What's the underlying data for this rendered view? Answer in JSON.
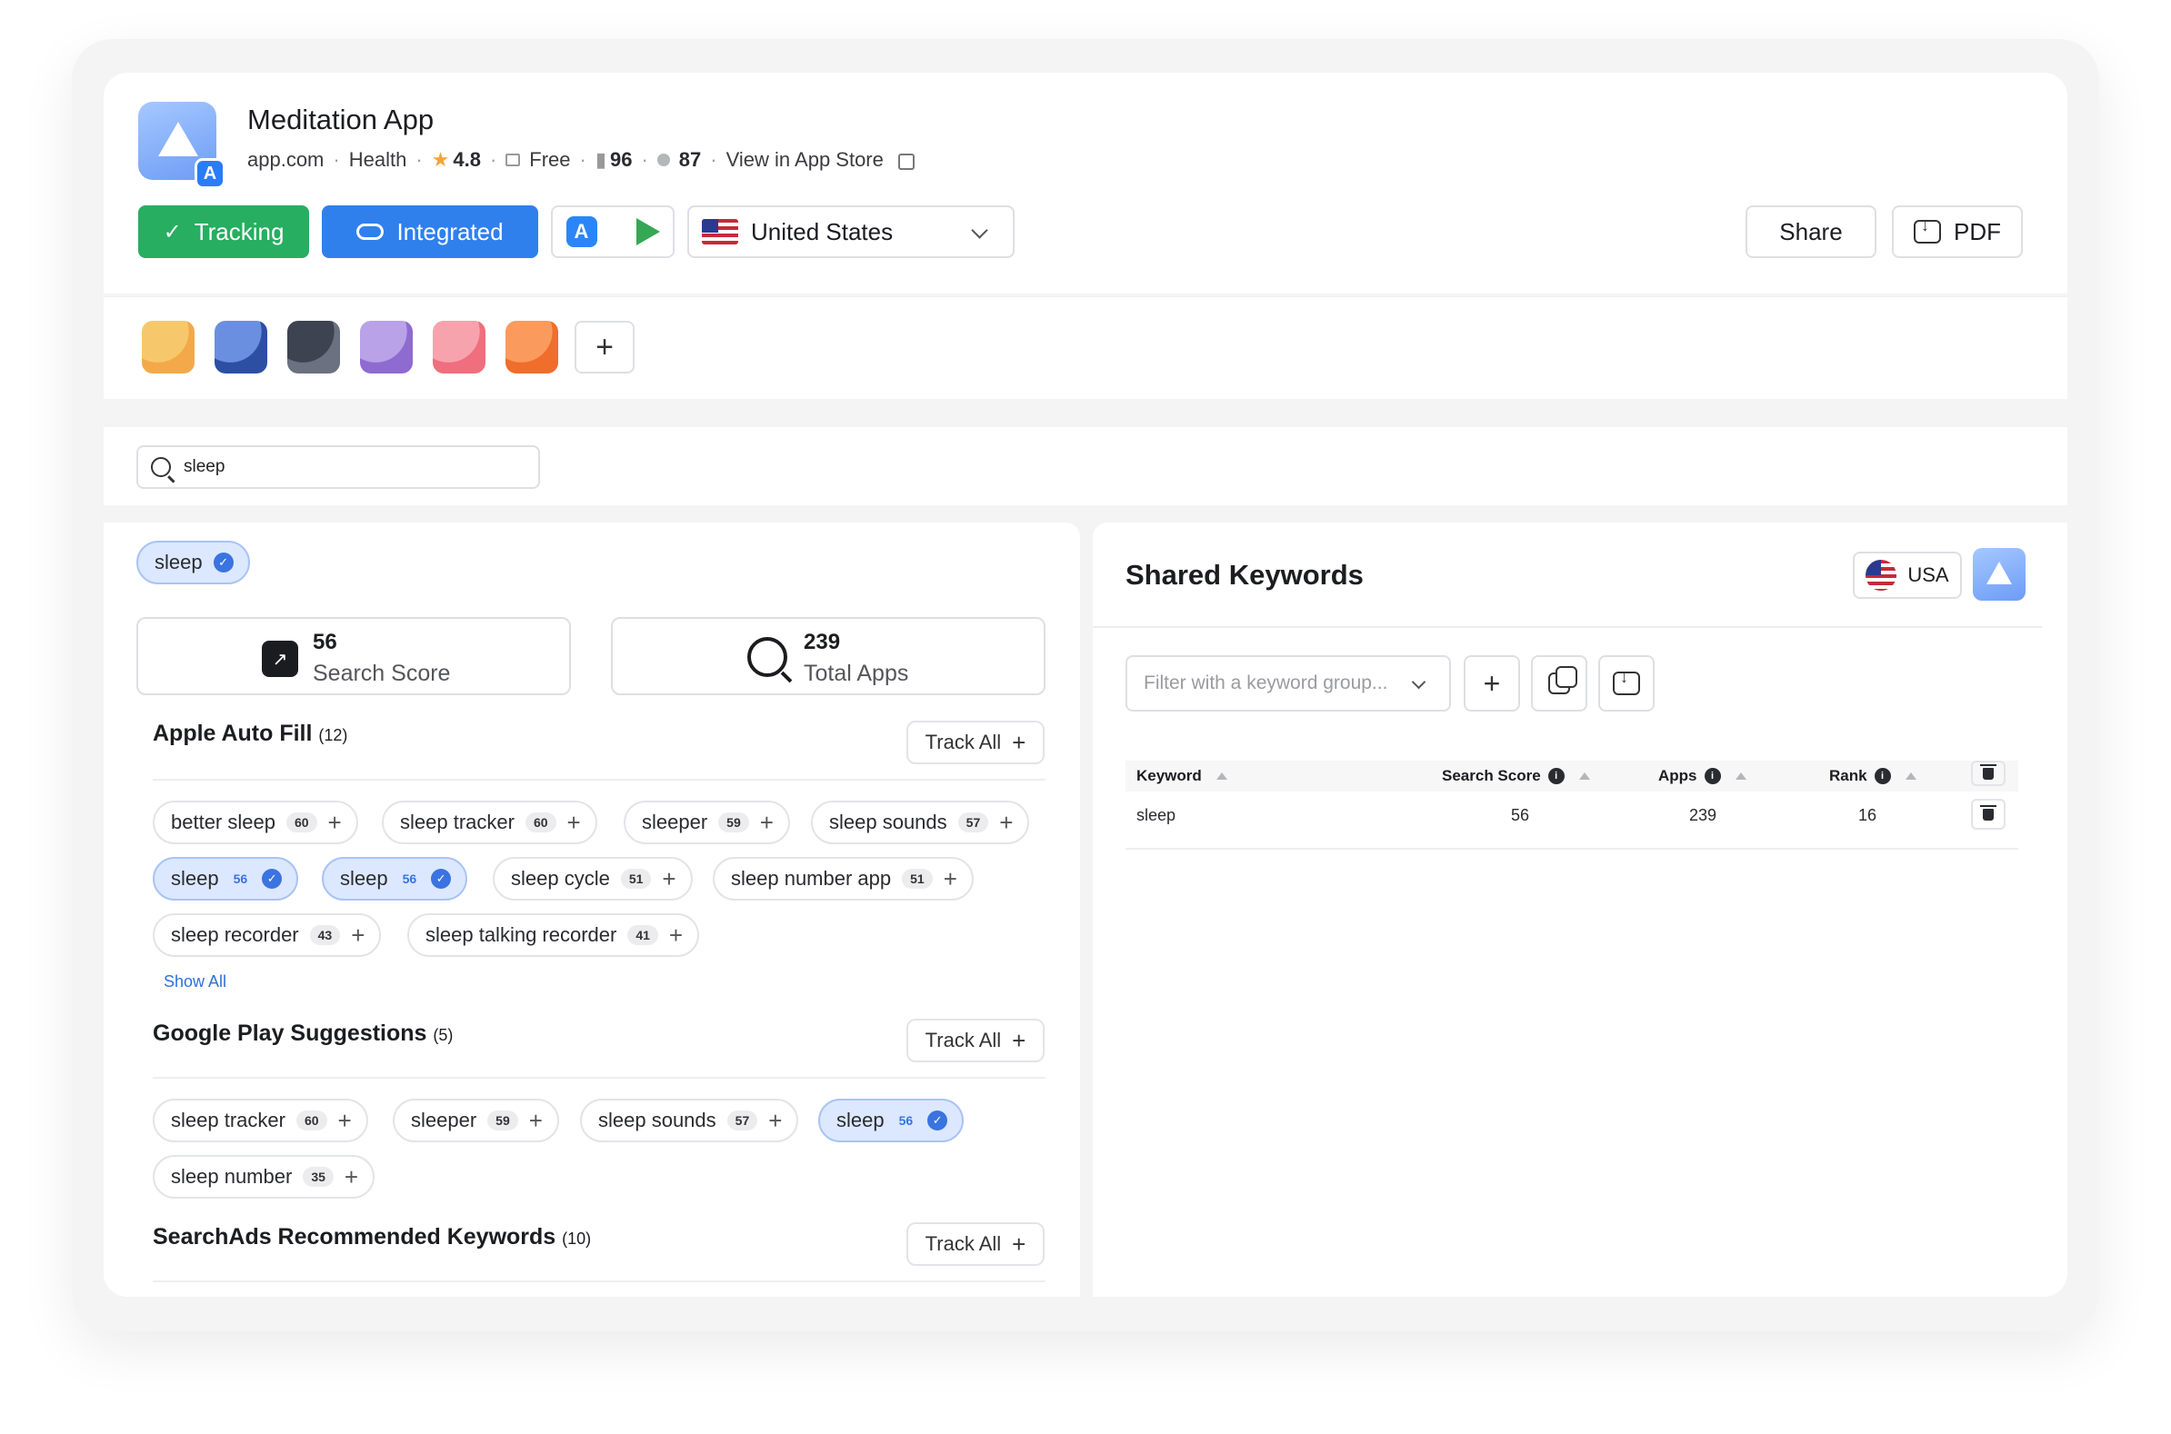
{
  "app": {
    "name": "Meditation App",
    "domain": "app.com",
    "category": "Health",
    "rating": "4.8",
    "price": "Free",
    "rank_count": "96",
    "score": "87",
    "store_link": "View in App Store",
    "accent": "#2f80ed"
  },
  "toolbar": {
    "tracking_label": "Tracking",
    "integrated_label": "Integrated",
    "country": "United States",
    "share_label": "Share",
    "pdf_label": "PDF"
  },
  "competitors": [
    {
      "colors": [
        "#f6c86b",
        "#f3a94a"
      ]
    },
    {
      "colors": [
        "#6b8fe0",
        "#2c4fa3"
      ]
    },
    {
      "colors": [
        "#3d4350",
        "#6b7180"
      ]
    },
    {
      "colors": [
        "#b9a2e8",
        "#8e6bd1"
      ]
    },
    {
      "colors": [
        "#f7a3ad",
        "#f06e7e"
      ]
    },
    {
      "colors": [
        "#fb9a5d",
        "#f06d2b"
      ]
    }
  ],
  "search": {
    "query": "sleep"
  },
  "selected_keyword": {
    "label": "sleep",
    "search_score": "56",
    "search_score_label": "Search Score",
    "total_apps": "239",
    "total_apps_label": "Total Apps"
  },
  "apple_autofill": {
    "title": "Apple Auto Fill",
    "count": "(12)",
    "track_all": "Track All",
    "show_all": "Show All",
    "chips": [
      {
        "label": "better sleep",
        "score": "60",
        "selected": false
      },
      {
        "label": "sleep tracker",
        "score": "60",
        "selected": false
      },
      {
        "label": "sleeper",
        "score": "59",
        "selected": false
      },
      {
        "label": "sleep sounds",
        "score": "57",
        "selected": false
      },
      {
        "label": "sleep",
        "score": "56",
        "selected": true
      },
      {
        "label": "sleep",
        "score": "56",
        "selected": true
      },
      {
        "label": "sleep cycle",
        "score": "51",
        "selected": false
      },
      {
        "label": "sleep number app",
        "score": "51",
        "selected": false
      },
      {
        "label": "sleep recorder",
        "score": "43",
        "selected": false
      },
      {
        "label": "sleep talking recorder",
        "score": "41",
        "selected": false
      }
    ]
  },
  "google_suggestions": {
    "title": "Google Play Suggestions",
    "count": "(5)",
    "track_all": "Track All",
    "chips": [
      {
        "label": "sleep tracker",
        "score": "60",
        "selected": false
      },
      {
        "label": "sleeper",
        "score": "59",
        "selected": false
      },
      {
        "label": "sleep sounds",
        "score": "57",
        "selected": false
      },
      {
        "label": "sleep",
        "score": "56",
        "selected": true
      },
      {
        "label": "sleep number",
        "score": "35",
        "selected": false
      }
    ]
  },
  "searchads": {
    "title": "SearchAds Recommended Keywords",
    "count": "(10)",
    "track_all": "Track All"
  },
  "shared_keywords": {
    "title": "Shared Keywords",
    "country": "USA",
    "filter_placeholder": "Filter with a keyword group...",
    "columns": [
      "Keyword",
      "Search Score",
      "Apps",
      "Rank"
    ],
    "rows": [
      {
        "keyword": "sleep",
        "search_score": "56",
        "apps": "239",
        "rank": "16"
      }
    ]
  }
}
